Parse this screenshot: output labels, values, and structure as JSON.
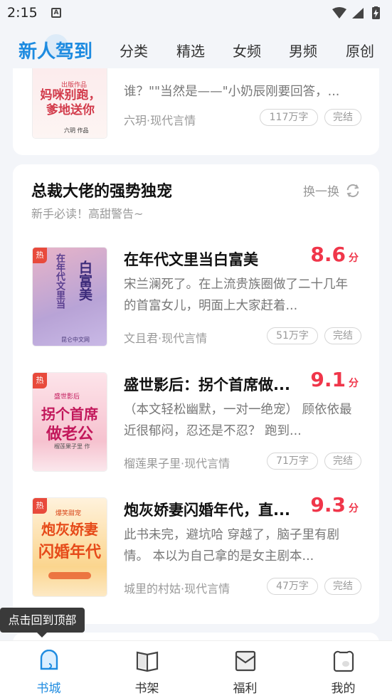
{
  "status": {
    "time": "2:15",
    "notif_glyph": "A"
  },
  "nav": {
    "tabs": [
      {
        "label": "新人驾到",
        "active": true
      },
      {
        "label": "分类"
      },
      {
        "label": "精选"
      },
      {
        "label": "女频"
      },
      {
        "label": "男频"
      },
      {
        "label": "原创"
      }
    ]
  },
  "prev_book": {
    "desc": "谁？\"\"当然是——\"小奶辰刚要回答，...",
    "author": "六玥·现代言情",
    "words": "117万字",
    "status": "完结",
    "cover_title": "妈咪别跑，爹地送你",
    "cover_small": "出版作品",
    "cover_author": "六玥 作品"
  },
  "section": {
    "title": "总裁大佬的强势独宠",
    "subtitle": "新手必读！高甜警告~",
    "refresh_label": "换一换"
  },
  "books": [
    {
      "title": "在年代文里当白富美",
      "score": "8.6",
      "score_unit": "分",
      "desc": "宋兰澜死了。在上流贵族圈做了二十几年的首富女儿，明面上大家赶着...",
      "author": "文且君·现代言情",
      "words": "51万字",
      "status": "完结",
      "hot": "热",
      "cover_title_a": "白富美",
      "cover_title_b": "在年代文里当",
      "cover_publisher": "昆仑中文网",
      "cover_colors": [
        "#b8a3d6",
        "#e8b4c8"
      ]
    },
    {
      "title": "盛世影后：拐个首席做...",
      "score": "9.1",
      "score_unit": "分",
      "desc": "（本文轻松幽默，一对一绝宠） 顾依依最近很郁闷，忍还是不忍？ 跑到...",
      "author": "榴莲果子里·现代言情",
      "words": "71万字",
      "status": "完结",
      "hot": "热",
      "cover_title_a": "拐个首席",
      "cover_title_b": "做老公",
      "cover_small": "盛世影后",
      "cover_author": "榴莲果子里 作",
      "cover_colors": [
        "#fde4ea",
        "#f6c2cf"
      ]
    },
    {
      "title": "炮灰娇妻闪婚年代，直...",
      "score": "9.3",
      "score_unit": "分",
      "desc": "此书未完，避坑哈 穿越了，脑子里有剧情。 本以为自己拿的是女主剧本...",
      "author": "城里的村姑·现代言情",
      "words": "47万字",
      "status": "完结",
      "hot": "热",
      "cover_title_a": "炮灰娇妻",
      "cover_title_b": "闪婚年代",
      "cover_small": "爆笑甜宠",
      "cover_colors": [
        "#fff2dc",
        "#fbd58e"
      ]
    }
  ],
  "tooltip": "点击回到顶部",
  "bottom_nav": [
    {
      "label": "书城",
      "icon": "bookstore-icon",
      "active": true
    },
    {
      "label": "书架",
      "icon": "bookshelf-icon"
    },
    {
      "label": "福利",
      "icon": "welfare-icon"
    },
    {
      "label": "我的",
      "icon": "profile-icon"
    }
  ],
  "colors": {
    "accent": "#1e8be0",
    "score": "#f0364a",
    "hot": "#e84a3c",
    "background": "#f3f5f9"
  }
}
